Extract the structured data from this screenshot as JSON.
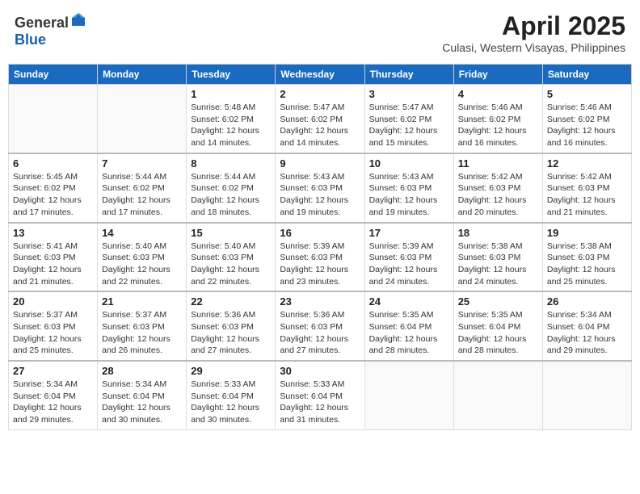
{
  "header": {
    "logo_general": "General",
    "logo_blue": "Blue",
    "month_year": "April 2025",
    "location": "Culasi, Western Visayas, Philippines"
  },
  "weekdays": [
    "Sunday",
    "Monday",
    "Tuesday",
    "Wednesday",
    "Thursday",
    "Friday",
    "Saturday"
  ],
  "weeks": [
    [
      {
        "day": "",
        "info": ""
      },
      {
        "day": "",
        "info": ""
      },
      {
        "day": "1",
        "info": "Sunrise: 5:48 AM\nSunset: 6:02 PM\nDaylight: 12 hours and 14 minutes."
      },
      {
        "day": "2",
        "info": "Sunrise: 5:47 AM\nSunset: 6:02 PM\nDaylight: 12 hours and 14 minutes."
      },
      {
        "day": "3",
        "info": "Sunrise: 5:47 AM\nSunset: 6:02 PM\nDaylight: 12 hours and 15 minutes."
      },
      {
        "day": "4",
        "info": "Sunrise: 5:46 AM\nSunset: 6:02 PM\nDaylight: 12 hours and 16 minutes."
      },
      {
        "day": "5",
        "info": "Sunrise: 5:46 AM\nSunset: 6:02 PM\nDaylight: 12 hours and 16 minutes."
      }
    ],
    [
      {
        "day": "6",
        "info": "Sunrise: 5:45 AM\nSunset: 6:02 PM\nDaylight: 12 hours and 17 minutes."
      },
      {
        "day": "7",
        "info": "Sunrise: 5:44 AM\nSunset: 6:02 PM\nDaylight: 12 hours and 17 minutes."
      },
      {
        "day": "8",
        "info": "Sunrise: 5:44 AM\nSunset: 6:02 PM\nDaylight: 12 hours and 18 minutes."
      },
      {
        "day": "9",
        "info": "Sunrise: 5:43 AM\nSunset: 6:03 PM\nDaylight: 12 hours and 19 minutes."
      },
      {
        "day": "10",
        "info": "Sunrise: 5:43 AM\nSunset: 6:03 PM\nDaylight: 12 hours and 19 minutes."
      },
      {
        "day": "11",
        "info": "Sunrise: 5:42 AM\nSunset: 6:03 PM\nDaylight: 12 hours and 20 minutes."
      },
      {
        "day": "12",
        "info": "Sunrise: 5:42 AM\nSunset: 6:03 PM\nDaylight: 12 hours and 21 minutes."
      }
    ],
    [
      {
        "day": "13",
        "info": "Sunrise: 5:41 AM\nSunset: 6:03 PM\nDaylight: 12 hours and 21 minutes."
      },
      {
        "day": "14",
        "info": "Sunrise: 5:40 AM\nSunset: 6:03 PM\nDaylight: 12 hours and 22 minutes."
      },
      {
        "day": "15",
        "info": "Sunrise: 5:40 AM\nSunset: 6:03 PM\nDaylight: 12 hours and 22 minutes."
      },
      {
        "day": "16",
        "info": "Sunrise: 5:39 AM\nSunset: 6:03 PM\nDaylight: 12 hours and 23 minutes."
      },
      {
        "day": "17",
        "info": "Sunrise: 5:39 AM\nSunset: 6:03 PM\nDaylight: 12 hours and 24 minutes."
      },
      {
        "day": "18",
        "info": "Sunrise: 5:38 AM\nSunset: 6:03 PM\nDaylight: 12 hours and 24 minutes."
      },
      {
        "day": "19",
        "info": "Sunrise: 5:38 AM\nSunset: 6:03 PM\nDaylight: 12 hours and 25 minutes."
      }
    ],
    [
      {
        "day": "20",
        "info": "Sunrise: 5:37 AM\nSunset: 6:03 PM\nDaylight: 12 hours and 25 minutes."
      },
      {
        "day": "21",
        "info": "Sunrise: 5:37 AM\nSunset: 6:03 PM\nDaylight: 12 hours and 26 minutes."
      },
      {
        "day": "22",
        "info": "Sunrise: 5:36 AM\nSunset: 6:03 PM\nDaylight: 12 hours and 27 minutes."
      },
      {
        "day": "23",
        "info": "Sunrise: 5:36 AM\nSunset: 6:03 PM\nDaylight: 12 hours and 27 minutes."
      },
      {
        "day": "24",
        "info": "Sunrise: 5:35 AM\nSunset: 6:04 PM\nDaylight: 12 hours and 28 minutes."
      },
      {
        "day": "25",
        "info": "Sunrise: 5:35 AM\nSunset: 6:04 PM\nDaylight: 12 hours and 28 minutes."
      },
      {
        "day": "26",
        "info": "Sunrise: 5:34 AM\nSunset: 6:04 PM\nDaylight: 12 hours and 29 minutes."
      }
    ],
    [
      {
        "day": "27",
        "info": "Sunrise: 5:34 AM\nSunset: 6:04 PM\nDaylight: 12 hours and 29 minutes."
      },
      {
        "day": "28",
        "info": "Sunrise: 5:34 AM\nSunset: 6:04 PM\nDaylight: 12 hours and 30 minutes."
      },
      {
        "day": "29",
        "info": "Sunrise: 5:33 AM\nSunset: 6:04 PM\nDaylight: 12 hours and 30 minutes."
      },
      {
        "day": "30",
        "info": "Sunrise: 5:33 AM\nSunset: 6:04 PM\nDaylight: 12 hours and 31 minutes."
      },
      {
        "day": "",
        "info": ""
      },
      {
        "day": "",
        "info": ""
      },
      {
        "day": "",
        "info": ""
      }
    ]
  ]
}
